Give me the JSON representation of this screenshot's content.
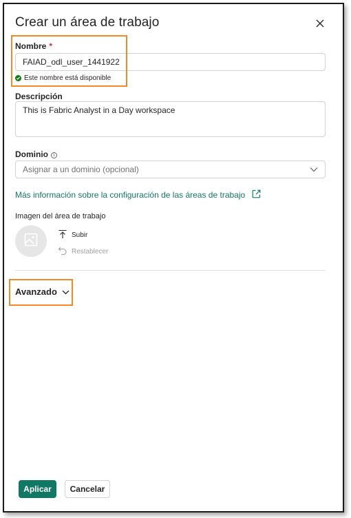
{
  "dialog": {
    "title": "Crear un área de trabajo"
  },
  "name_field": {
    "label": "Nombre",
    "required_mark": "*",
    "value": "FAIAD_odl_user_1441922",
    "status": "Este nombre está disponible"
  },
  "description_field": {
    "label": "Descripción",
    "value": "This is Fabric Analyst in a Day workspace"
  },
  "domain_field": {
    "label": "Dominio",
    "placeholder": "Asignar a un dominio (opcional)"
  },
  "learn_more_link": "Más información sobre la configuración de las áreas de trabajo",
  "image_section": {
    "label": "Imagen del área de trabajo",
    "upload_label": "Subir",
    "reset_label": "Restablecer"
  },
  "advanced": {
    "label": "Avanzado"
  },
  "footer": {
    "apply_label": "Aplicar",
    "cancel_label": "Cancelar"
  },
  "colors": {
    "accent": "#117865",
    "highlight": "#f08a24",
    "success": "#107c10",
    "required": "#c4314b"
  }
}
